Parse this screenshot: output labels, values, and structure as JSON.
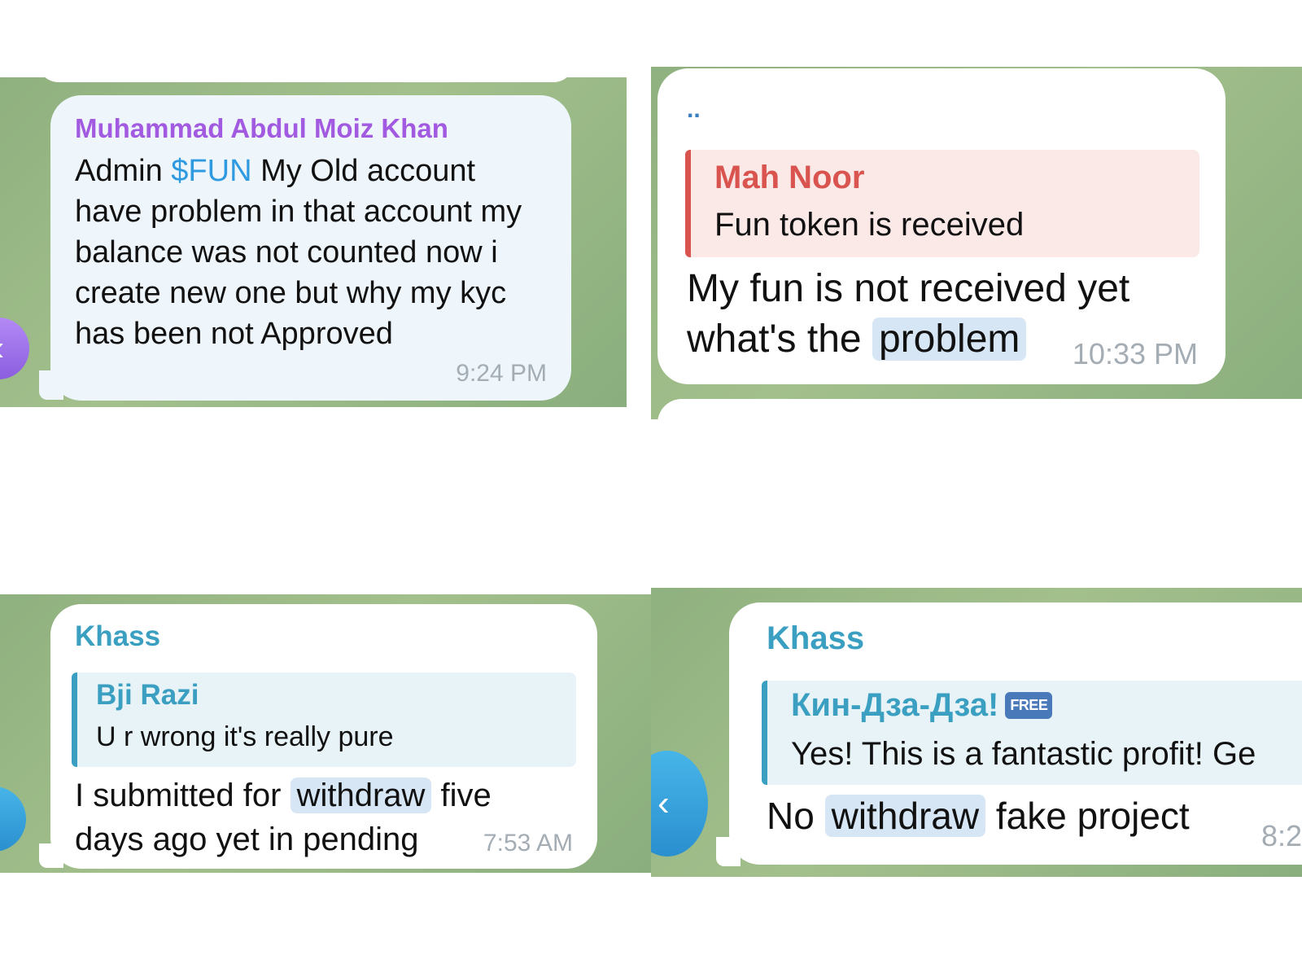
{
  "panel1": {
    "sender": "Muhammad Abdul Moiz Khan",
    "text_before": "Admin ",
    "mention": "$FUN",
    "text_after": " My Old account have problem in that account my balance was not counted now i create new one but why my kyc has been not Approved",
    "time": "9:24 PM",
    "avatar_glyph": "‹"
  },
  "panel2": {
    "dots": "..",
    "quote_name": "Mah Noor",
    "quote_text": "Fun token is received",
    "text_line1": "My fun is not received yet",
    "text_line2": "what's the ",
    "highlight": "problem",
    "time": "10:33 PM"
  },
  "panel3": {
    "sender": "Khass",
    "quote_name": "Bji Razi",
    "quote_text": "U r wrong it's really pure",
    "text_before": "I submitted for ",
    "highlight": "withdraw",
    "text_after": " five days ago yet in pending",
    "time": "7:53 AM"
  },
  "panel4": {
    "sender": "Khass",
    "quote_name": "Кин-Дза-Дза!",
    "badge": "FREE",
    "quote_text": "Yes! This is a fantastic profit! Ge",
    "text_before": "No ",
    "highlight": "withdraw",
    "text_after": " fake project",
    "time": "8:2",
    "avatar_glyph": "‹"
  },
  "colors": {
    "chat_background": "#9dbb86",
    "purple_name": "#a25be0",
    "teal_name": "#3a9fc0",
    "red_name": "#d9534f",
    "mention": "#2f9ae0",
    "highlight": "#d6e6f5",
    "timestamp": "#a4acb4"
  }
}
